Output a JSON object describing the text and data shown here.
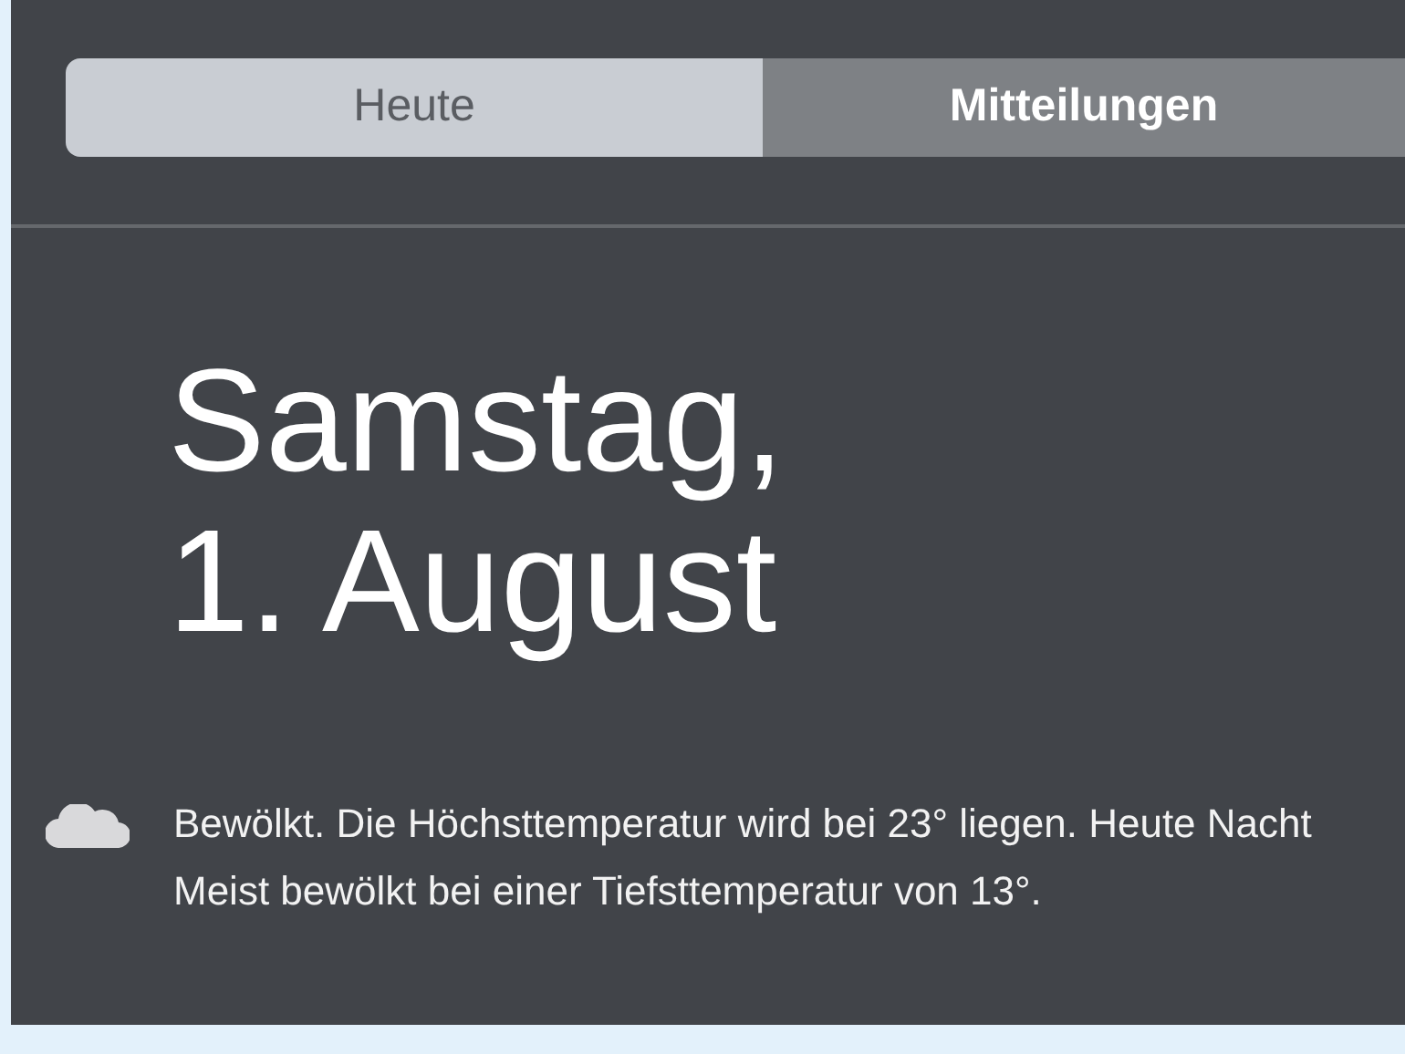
{
  "tabs": [
    {
      "label": "Heute",
      "selected": false
    },
    {
      "label": "Mitteilungen",
      "selected": true
    }
  ],
  "date": {
    "line_1": "Samstag,",
    "line_2": "1. August"
  },
  "weather": {
    "text": "Bewölkt. Die Höchsttemperatur wird bei 23° liegen. Heute Nacht Meist bewölkt bei einer Tiefsttemperatur von 13°."
  }
}
